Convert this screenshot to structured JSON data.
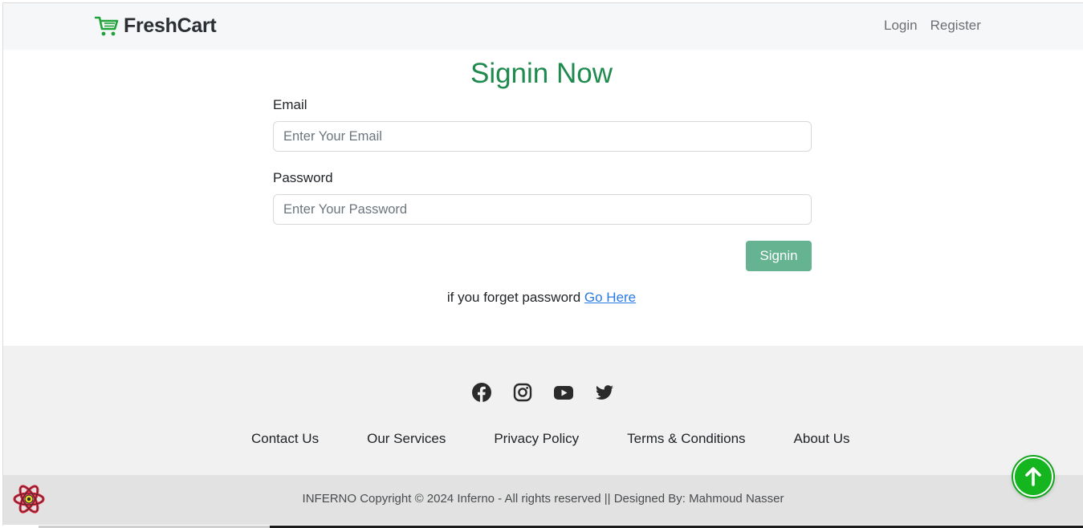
{
  "navbar": {
    "brand": "FreshCart",
    "login": "Login",
    "register": "Register"
  },
  "form": {
    "title": "Signin Now",
    "email_label": "Email",
    "email_placeholder": "Enter Your Email",
    "email_value": "",
    "password_label": "Password",
    "password_placeholder": "Enter Your Password",
    "password_value": "",
    "submit_label": "Signin",
    "forget_text": "if you forget password",
    "forget_link": "Go Here"
  },
  "footer": {
    "socials": [
      "facebook-icon",
      "instagram-icon",
      "youtube-icon",
      "twitter-icon"
    ],
    "links": [
      "Contact Us",
      "Our Services",
      "Privacy Policy",
      "Terms & Conditions",
      "About Us"
    ],
    "copyright": "INFERNO Copyright © 2024 Inferno - All rights reserved || Designed By: Mahmoud Nasser"
  },
  "colors": {
    "brand_green": "#1f8a4e",
    "button_green": "#66b391",
    "scroll_top": "#14b51f",
    "link_blue": "#2a7ae2"
  }
}
